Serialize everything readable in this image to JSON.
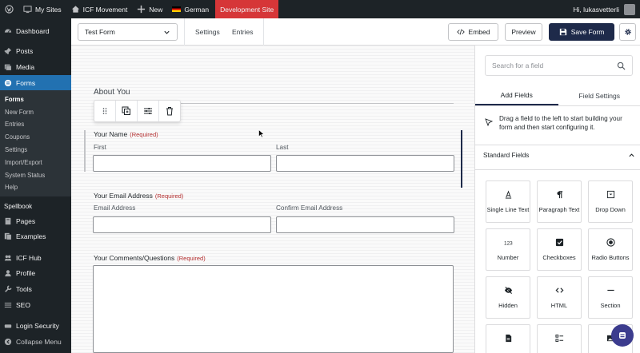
{
  "adminbar": {
    "wp_icon": "wordpress-icon",
    "my_sites": "My Sites",
    "site_name": "ICF Movement",
    "new_label": "New",
    "language": "German",
    "dev_site": "Development Site",
    "greeting": "Hi, lukasvetterli"
  },
  "sidebar": {
    "items_top": [
      {
        "label": "Dashboard",
        "icon": "dashboard-icon"
      }
    ],
    "items_mid": [
      {
        "label": "Posts",
        "icon": "pin-icon"
      },
      {
        "label": "Media",
        "icon": "media-icon"
      },
      {
        "label": "Forms",
        "icon": "forms-icon"
      }
    ],
    "forms_submenu": [
      "Forms",
      "New Form",
      "Entries",
      "Coupons",
      "Settings",
      "Import/Export",
      "System Status",
      "Help"
    ],
    "items_bottom": [
      {
        "label": "Spellbook",
        "icon": ""
      },
      {
        "label": "Pages",
        "icon": "page-icon"
      },
      {
        "label": "Examples",
        "icon": "examples-icon"
      },
      {
        "label": "ICF Hub",
        "icon": "hub-icon"
      },
      {
        "label": "Profile",
        "icon": "user-icon"
      },
      {
        "label": "Tools",
        "icon": "wrench-icon"
      },
      {
        "label": "SEO",
        "icon": "seo-icon"
      },
      {
        "label": "Login Security",
        "icon": "security-icon"
      },
      {
        "label": "Collapse Menu",
        "icon": "collapse-icon"
      }
    ]
  },
  "topbar": {
    "form_name": "Test Form",
    "settings": "Settings",
    "entries": "Entries",
    "embed": "Embed",
    "preview": "Preview",
    "save": "Save Form"
  },
  "form": {
    "section_title": "About You",
    "required": "(Required)",
    "name_label": "Your Name",
    "first": "First",
    "last": "Last",
    "email_label": "Your Email Address",
    "email_sub": "Email Address",
    "confirm_sub": "Confirm Email Address",
    "comments_label": "Your Comments/Questions"
  },
  "panel": {
    "search_placeholder": "Search for a field",
    "tab_add": "Add Fields",
    "tab_settings": "Field Settings",
    "hint": "Drag a field to the left to start building your form and then start configuring it.",
    "standard_fields": "Standard Fields",
    "tiles": [
      {
        "label": "Single Line Text",
        "icon": "text-icon"
      },
      {
        "label": "Paragraph Text",
        "icon": "paragraph-icon"
      },
      {
        "label": "Drop Down",
        "icon": "dropdown-icon"
      },
      {
        "label": "Number",
        "icon": "number-icon"
      },
      {
        "label": "Checkboxes",
        "icon": "checkbox-icon"
      },
      {
        "label": "Radio Buttons",
        "icon": "radio-icon"
      },
      {
        "label": "Hidden",
        "icon": "hidden-icon"
      },
      {
        "label": "HTML",
        "icon": "code-icon"
      },
      {
        "label": "Section",
        "icon": "section-icon"
      },
      {
        "label": "",
        "icon": "document-icon"
      },
      {
        "label": "",
        "icon": "list-icon"
      },
      {
        "label": "",
        "icon": "image-icon"
      }
    ]
  },
  "colors": {
    "admin_dark": "#1d2327",
    "wp_blue": "#2271b1",
    "dev_red": "#d63638",
    "primary_navy": "#1e2a4a",
    "required_red": "#b32d2e"
  }
}
